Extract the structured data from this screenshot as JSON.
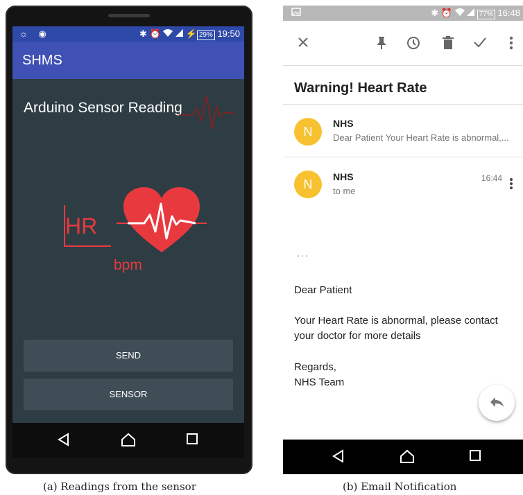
{
  "panel_a": {
    "status": {
      "left_icons": "☼ ◉",
      "bluetooth": "✱",
      "alarm": "⏰",
      "battery": "29%",
      "time": "19:50"
    },
    "app_title": "SHMS",
    "reading_title": "Arduino Sensor Reading",
    "hr_label": "HR",
    "bpm_label": "bpm",
    "buttons": {
      "send": "SEND",
      "sensor": "SENSOR"
    },
    "accent_color": "#e8393f",
    "icons": [
      "back-icon",
      "home-icon",
      "recents-icon",
      "heart-icon",
      "ecg-icon"
    ]
  },
  "panel_b": {
    "status": {
      "battery": "77%",
      "time": "16:48"
    },
    "subject": "Warning! Heart Rate",
    "thread": [
      {
        "avatar_letter": "N",
        "sender": "NHS",
        "snippet": "Dear Patient Your Heart Rate is abnormal,..."
      },
      {
        "avatar_letter": "N",
        "sender": "NHS",
        "recipient": "to me",
        "time": "16:44"
      }
    ],
    "ellipsis": "···",
    "body": {
      "greeting": "Dear Patient",
      "message": "Your Heart Rate is abnormal, please contact your doctor for more details",
      "closing": "Regards,",
      "signature": "NHS Team"
    },
    "icons": [
      "close-icon",
      "pin-icon",
      "snooze-icon",
      "delete-icon",
      "done-icon",
      "more-vert-icon",
      "reply-icon"
    ]
  },
  "captions": {
    "a": "(a) Readings from the sensor",
    "b": "(b) Email Notification"
  }
}
